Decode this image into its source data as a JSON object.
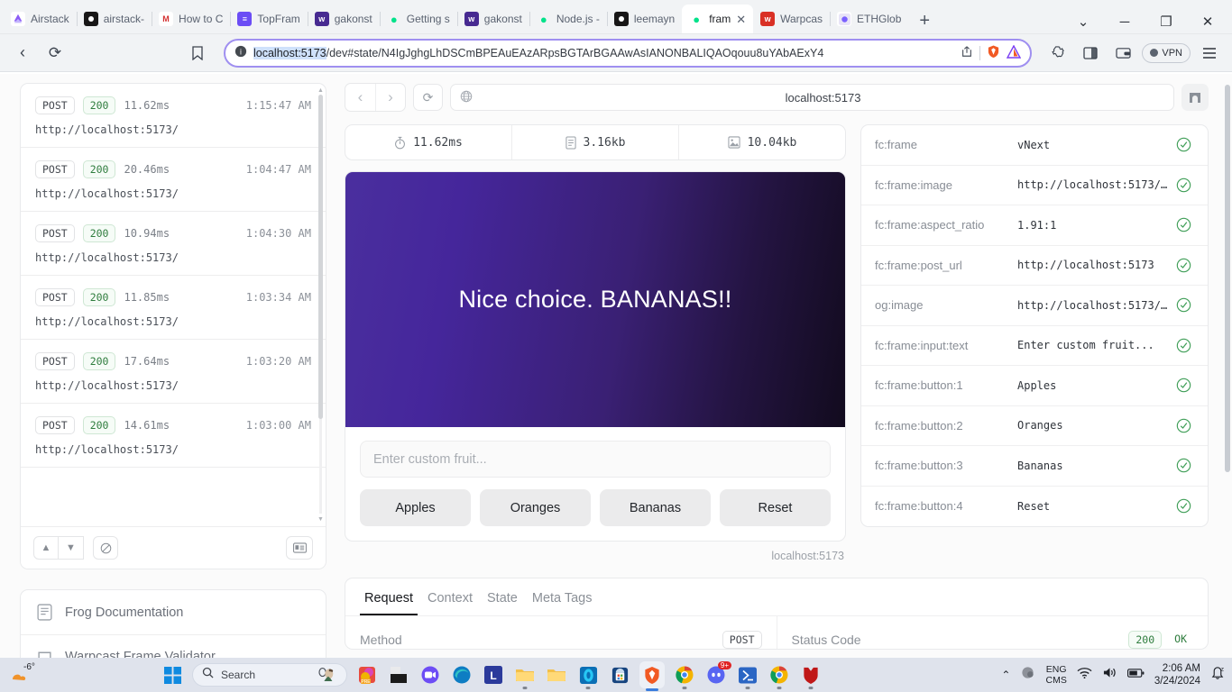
{
  "browser": {
    "tabs": [
      {
        "label": "Airstack",
        "favicon": "airstack-icon",
        "color": "#7b5cf0",
        "active": false
      },
      {
        "label": "airstack-",
        "favicon": "github-icon",
        "color": "#181717",
        "active": false
      },
      {
        "label": "How to C",
        "favicon": "medium-icon",
        "color": "#ffffff",
        "active": false
      },
      {
        "label": "TopFram",
        "favicon": "topframe-icon",
        "color": "#6b4df5",
        "active": false
      },
      {
        "label": "gakonst",
        "favicon": "warpcast-icon",
        "color": "#472a91",
        "active": false
      },
      {
        "label": "Getting s",
        "favicon": "frog-icon",
        "color": "#00e28a",
        "active": false
      },
      {
        "label": "gakonst",
        "favicon": "warpcast-icon",
        "color": "#472a91",
        "active": false
      },
      {
        "label": "Node.js -",
        "favicon": "frog-icon",
        "color": "#00e28a",
        "active": false
      },
      {
        "label": "leemayn",
        "favicon": "github-icon",
        "color": "#181717",
        "active": false
      },
      {
        "label": "fram",
        "favicon": "frog-icon",
        "color": "#00e28a",
        "active": true
      },
      {
        "label": "Warpcas",
        "favicon": "warpcast-icon",
        "color": "#d93025",
        "active": false
      },
      {
        "label": "ETHGlob",
        "favicon": "ethglobal-icon",
        "color": "#ffffff",
        "active": false
      }
    ],
    "new_tab_label": "+",
    "tab_close_label": "✕",
    "window_controls": {
      "search": "⌄",
      "minimize": "─",
      "maximize": "❐",
      "close": "✕"
    },
    "nav": {
      "back": "‹",
      "forward": "›",
      "reload": "⟳",
      "bookmark": "bookmark-icon"
    },
    "url": {
      "host": "localhost:5173",
      "rest": "/dev#state/N4IgJghgLhDSCmBPEAuEAzARpsBGTArBGAAwAsIANONBALIQAOqouu8uYAbAExY4",
      "info_icon": "site-info-icon",
      "share_icon": "share-icon",
      "shield_icon": "brave-shield-icon",
      "warning_icon": "brave-triangle-icon"
    },
    "toolbar_right": {
      "extensions": "puzzle-icon",
      "sidebar": "sidebar-icon",
      "wallet": "wallet-icon",
      "vpn_label": "VPN",
      "menu": "hamburger-icon"
    }
  },
  "requests": {
    "rows": [
      {
        "method": "POST",
        "status": "200",
        "duration": "11.62ms",
        "time": "1:15:47 AM",
        "url": "http://localhost:5173/"
      },
      {
        "method": "POST",
        "status": "200",
        "duration": "20.46ms",
        "time": "1:04:47 AM",
        "url": "http://localhost:5173/"
      },
      {
        "method": "POST",
        "status": "200",
        "duration": "10.94ms",
        "time": "1:04:30 AM",
        "url": "http://localhost:5173/"
      },
      {
        "method": "POST",
        "status": "200",
        "duration": "11.85ms",
        "time": "1:03:34 AM",
        "url": "http://localhost:5173/"
      },
      {
        "method": "POST",
        "status": "200",
        "duration": "17.64ms",
        "time": "1:03:20 AM",
        "url": "http://localhost:5173/"
      },
      {
        "method": "POST",
        "status": "200",
        "duration": "14.61ms",
        "time": "1:03:00 AM",
        "url": "http://localhost:5173/"
      }
    ],
    "footer": {
      "prev": "chevron-up-icon",
      "next": "chevron-down-icon",
      "clear": "clear-icon",
      "panel": "details-panel-icon"
    }
  },
  "links": [
    {
      "label": "Frog Documentation",
      "icon": "document-icon"
    },
    {
      "label": "Warpcast Frame Validator",
      "icon": "warpcast-icon"
    }
  ],
  "frame": {
    "nav": {
      "back": "‹",
      "forward": "›",
      "reload": "⟳",
      "globe": "globe-icon",
      "arch": "arch-icon"
    },
    "url": "localhost:5173",
    "metrics": [
      {
        "icon": "stopwatch-icon",
        "value": "11.62ms"
      },
      {
        "icon": "document-icon",
        "value": "3.16kb"
      },
      {
        "icon": "image-icon",
        "value": "10.04kb"
      }
    ],
    "image_text": "Nice choice. BANANAS!!",
    "input_placeholder": "Enter custom fruit...",
    "buttons": [
      "Apples",
      "Oranges",
      "Bananas",
      "Reset"
    ],
    "host_label": "localhost:5173"
  },
  "meta": {
    "rows": [
      {
        "key": "fc:frame",
        "value": "vNext",
        "status": "valid"
      },
      {
        "key": "fc:frame:image",
        "value": "http://localhost:5173/i…",
        "status": "valid"
      },
      {
        "key": "fc:frame:aspect_ratio",
        "value": "1.91:1",
        "status": "valid"
      },
      {
        "key": "fc:frame:post_url",
        "value": "http://localhost:5173",
        "status": "valid"
      },
      {
        "key": "og:image",
        "value": "http://localhost:5173/i…",
        "status": "valid"
      },
      {
        "key": "fc:frame:input:text",
        "value": "Enter custom fruit...",
        "status": "valid"
      },
      {
        "key": "fc:frame:button:1",
        "value": "Apples",
        "status": "valid"
      },
      {
        "key": "fc:frame:button:2",
        "value": "Oranges",
        "status": "valid"
      },
      {
        "key": "fc:frame:button:3",
        "value": "Bananas",
        "status": "valid"
      },
      {
        "key": "fc:frame:button:4",
        "value": "Reset",
        "status": "valid"
      }
    ],
    "check_icon": "check-circle-icon",
    "valid_color": "#2f7d3e"
  },
  "details": {
    "tabs": [
      "Request",
      "Context",
      "State",
      "Meta Tags"
    ],
    "active_tab": "Request",
    "method_label": "Method",
    "method_value": "POST",
    "status_label": "Status Code",
    "status_value": "200",
    "status_text": "OK"
  },
  "taskbar": {
    "weather_temp": "-6°",
    "start": "windows-start-icon",
    "search_placeholder": "Search",
    "search_icon": "search-icon",
    "copilot_icon": "copilot-icon",
    "apps": [
      {
        "name": "powerpoint-icon",
        "color": "#d24726"
      },
      {
        "name": "adobe-icon",
        "color": "#1a1a1a"
      },
      {
        "name": "zoom-icon",
        "color": "#4a8cff"
      },
      {
        "name": "edge-icon",
        "color": "#0f7ebf"
      },
      {
        "name": "lastpass-icon",
        "color": "#2f3a8f"
      },
      {
        "name": "explorer-icon",
        "color": "#ffc107"
      },
      {
        "name": "folder-icon",
        "color": "#ffcb47"
      },
      {
        "name": "terminal-icon",
        "color": "#00a8e8"
      },
      {
        "name": "store-icon",
        "color": "#1b4b8f"
      },
      {
        "name": "brave-icon",
        "color": "#f15a24"
      },
      {
        "name": "chrome-icon",
        "color": "#f4b400"
      },
      {
        "name": "discord-icon",
        "color": "#5865f2",
        "badge": "9+"
      },
      {
        "name": "powershell-icon",
        "color": "#2b66c4"
      },
      {
        "name": "chrome-icon",
        "color": "#f4b400"
      },
      {
        "name": "mcafee-icon",
        "color": "#c01818"
      }
    ],
    "tray": {
      "chevron": "⌃",
      "overflow_icon": "tray-overflow-icon",
      "lang_top": "ENG",
      "lang_bottom": "CMS",
      "wifi": "wifi-icon",
      "volume": "volume-icon",
      "battery": "battery-icon",
      "time": "2:06 AM",
      "date": "3/24/2024",
      "notifications": "notification-icon"
    }
  }
}
